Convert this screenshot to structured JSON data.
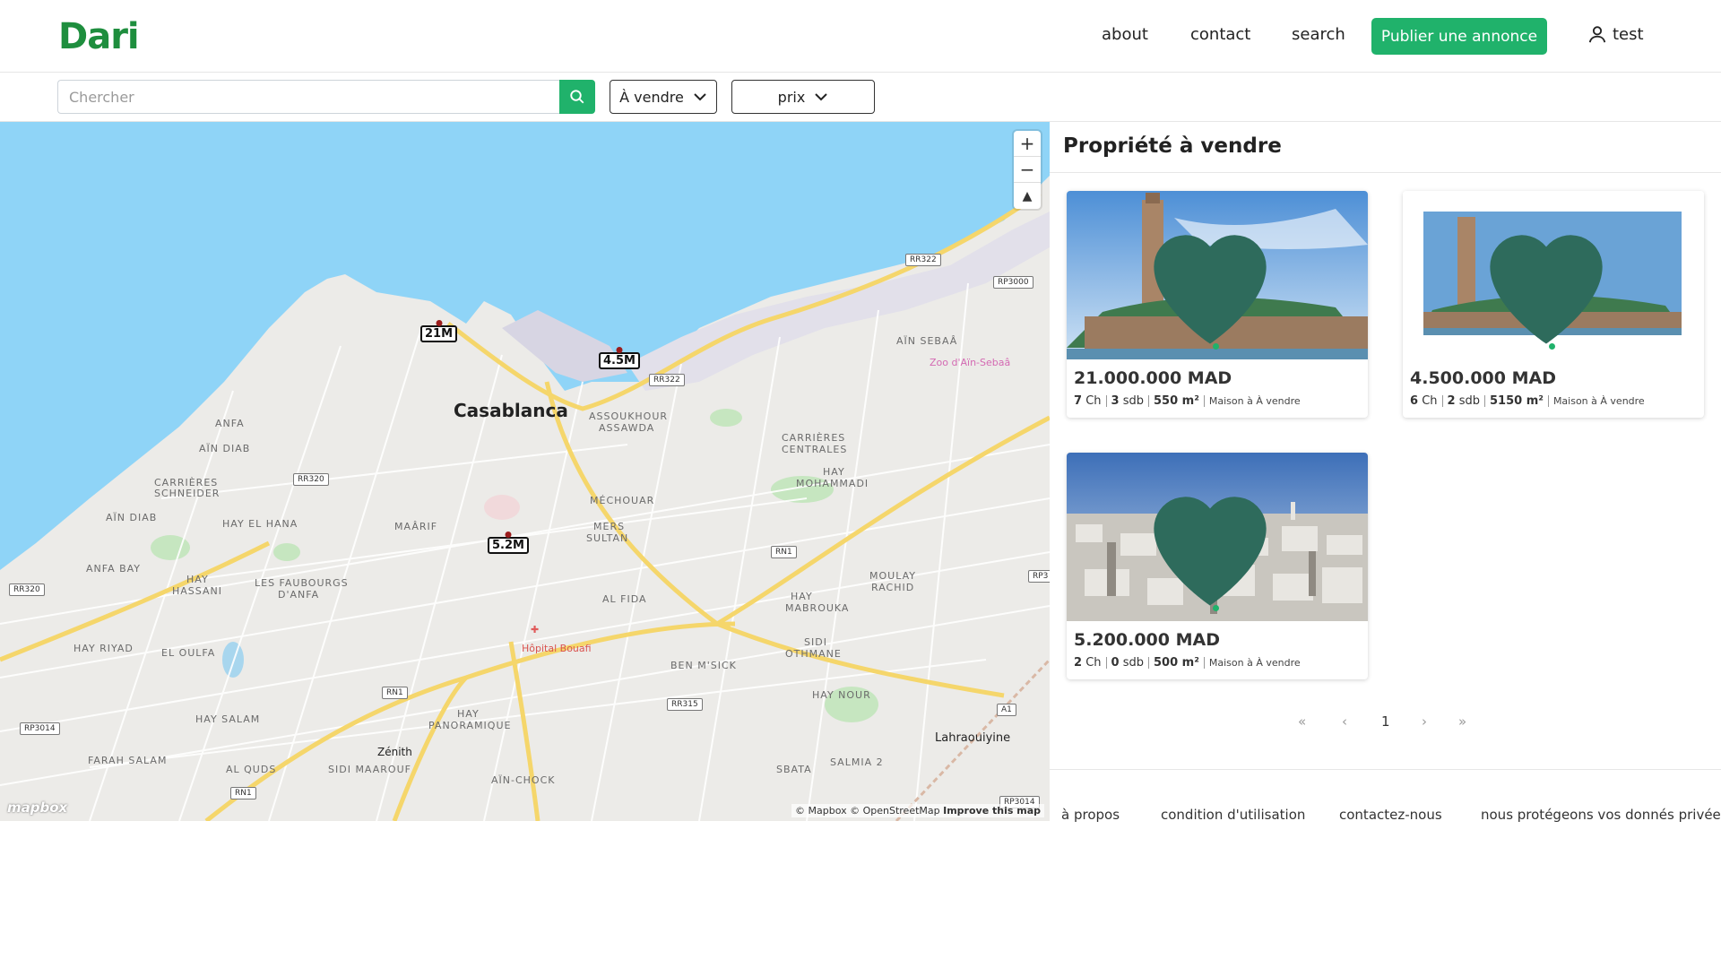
{
  "header": {
    "logo": "Dari",
    "nav": {
      "about": "about",
      "contact": "contact",
      "search": "search"
    },
    "publish_button": "Publier une annonce",
    "user_name": "test"
  },
  "search": {
    "placeholder": "Chercher",
    "value": "",
    "type_filter": "À vendre",
    "price_filter": "prix"
  },
  "map": {
    "city": "Casablanca",
    "labels": {
      "anfa": "ANFA",
      "ain_diab": "AÏN DIAB",
      "carrieres_schneider_1": "CARRIÈRES",
      "carrieres_schneider_2": "SCHNEIDER",
      "ain_diab2": "AÏN DIAB",
      "hay_el_hana": "HAY EL HANA",
      "anfa_bay": "ANFA BAY",
      "hay_hassani_1": "HAY",
      "hay_hassani_2": "HASSANI",
      "faubourgs_1": "LES FAUBOURGS",
      "faubourgs_2": "D'ANFA",
      "maarif": "MAÂRIF",
      "mechouar": "MÉCHOUAR",
      "mers_sultan_1": "MERS",
      "mers_sultan_2": "SULTAN",
      "assoukhour_1": "ASSOUKHOUR",
      "assoukhour_2": "ASSAWDA",
      "ain_sebaa": "AÏN SEBAÂ",
      "carrieres_centrales_1": "CARRIÈRES",
      "carrieres_centrales_2": "CENTRALES",
      "hay_mohammadi_1": "HAY",
      "hay_mohammadi_2": "MOHAMMADI",
      "al_fida": "AL FIDA",
      "hay_mabrouka_1": "HAY",
      "hay_mabrouka_2": "MABROUKA",
      "moulay_rachid_1": "MOULAY",
      "moulay_rachid_2": "RACHID",
      "sidi_othmane_1": "SIDI",
      "sidi_othmane_2": "OTHMANE",
      "hay_riyad": "HAY RIYAD",
      "el_oulfa": "EL OULFA",
      "hay_salam": "HAY SALAM",
      "farah_salam": "FARAH SALAM",
      "al_quds": "AL QUDS",
      "hay_panoramique_1": "HAY",
      "hay_panoramique_2": "PANORAMIQUE",
      "sidi_maarouf": "SIDI MAAROUF",
      "zenith": "Zénith",
      "ain_chock": "AÏN-CHOCK",
      "ben_msick": "BEN M'SICK",
      "hay_nour": "HAY NOUR",
      "sbata": "SBATA",
      "salmia": "SALMIA 2",
      "lahraouiyine": "Lahraouiyine",
      "hopital": "Hôpital Bouafi",
      "zoo": "Zoo d'Aïn-Sebaâ"
    },
    "roads": {
      "rr322_a": "RR322",
      "rr322_b": "RR322",
      "rp3000": "RP3000",
      "rr320_a": "RR320",
      "rr320_b": "RR320",
      "rn1_a": "RN1",
      "rn1_b": "RN1",
      "rn1_c": "RN1",
      "rr315": "RR315",
      "rp3014_a": "RP3014",
      "rp3014_b": "RP3014",
      "a1": "A1",
      "rp3": "RP3"
    },
    "markers": [
      "21M",
      "4.5M",
      "5.2M"
    ],
    "attribution": "© Mapbox © OpenStreetMap",
    "improve": "Improve this map",
    "mapbox_logo": "mapbox"
  },
  "listings": {
    "title": "Propriété à vendre",
    "cards": [
      {
        "price": "21.000.000 MAD",
        "ch": "7",
        "ch_label": "Ch",
        "sdb": "3",
        "sdb_label": "sdb",
        "area": "550 m²",
        "type": "Maison à À vendre"
      },
      {
        "price": "4.500.000 MAD",
        "ch": "6",
        "ch_label": "Ch",
        "sdb": "2",
        "sdb_label": "sdb",
        "area": "5150 m²",
        "type": "Maison à À vendre"
      },
      {
        "price": "5.200.000 MAD",
        "ch": "2",
        "ch_label": "Ch",
        "sdb": "0",
        "sdb_label": "sdb",
        "area": "500 m²",
        "type": "Maison à À vendre"
      }
    ]
  },
  "pagination": {
    "first": "«",
    "prev": "‹",
    "current": "1",
    "next": "›",
    "last": "»"
  },
  "footer": {
    "about": "à propos",
    "terms": "condition d'utilisation",
    "contact": "contactez-nous",
    "privacy": "nous protégeons vos donnés privées"
  },
  "colors": {
    "brand": "#20b26b",
    "logo": "#1e8e3e",
    "heart": "#2e6b5c"
  }
}
